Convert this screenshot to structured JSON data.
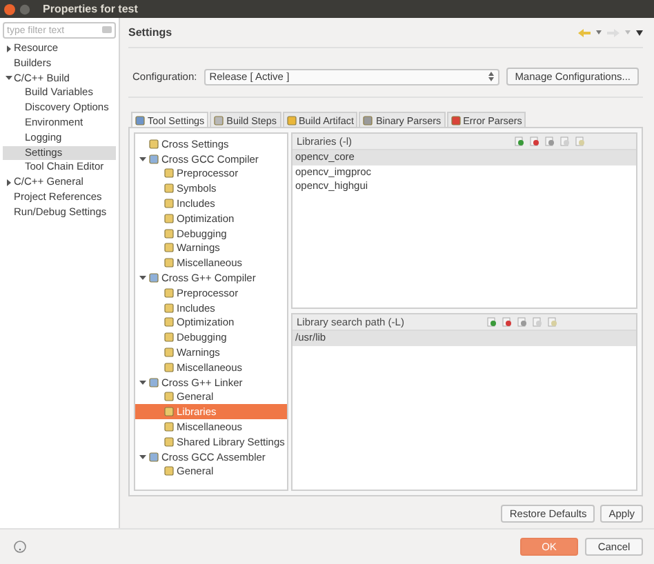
{
  "window": {
    "title": "Properties for test"
  },
  "filter": {
    "placeholder": "type filter text"
  },
  "sidebar": {
    "items": [
      {
        "label": "Resource",
        "expanded": false,
        "selected": false
      },
      {
        "label": "Builders",
        "selected": false
      },
      {
        "label": "C/C++ Build",
        "expanded": true,
        "selected": false,
        "children": [
          {
            "label": "Build Variables",
            "selected": false
          },
          {
            "label": "Discovery Options",
            "selected": false
          },
          {
            "label": "Environment",
            "selected": false
          },
          {
            "label": "Logging",
            "selected": false
          },
          {
            "label": "Settings",
            "selected": true
          },
          {
            "label": "Tool Chain Editor",
            "selected": false
          }
        ]
      },
      {
        "label": "C/C++ General",
        "expanded": false,
        "selected": false
      },
      {
        "label": "Project References",
        "selected": false
      },
      {
        "label": "Run/Debug Settings",
        "selected": false
      }
    ]
  },
  "page_title": "Settings",
  "configuration": {
    "label": "Configuration:",
    "value": "Release  [ Active ]",
    "button": "Manage Configurations..."
  },
  "tabs": [
    {
      "label": "Tool Settings",
      "selected": true
    },
    {
      "label": "Build Steps",
      "selected": false
    },
    {
      "label": "Build Artifact",
      "selected": false
    },
    {
      "label": "Binary Parsers",
      "selected": false
    },
    {
      "label": "Error Parsers",
      "selected": false
    }
  ],
  "tool_tree": [
    {
      "label": "Cross Settings",
      "kind": "leaf",
      "selected": false
    },
    {
      "label": "Cross GCC Compiler",
      "kind": "tool",
      "expanded": true,
      "children": [
        {
          "label": "Preprocessor",
          "kind": "leaf",
          "selected": false
        },
        {
          "label": "Symbols",
          "kind": "leaf",
          "selected": false
        },
        {
          "label": "Includes",
          "kind": "leaf",
          "selected": false
        },
        {
          "label": "Optimization",
          "kind": "leaf",
          "selected": false
        },
        {
          "label": "Debugging",
          "kind": "leaf",
          "selected": false
        },
        {
          "label": "Warnings",
          "kind": "leaf",
          "selected": false
        },
        {
          "label": "Miscellaneous",
          "kind": "leaf",
          "selected": false
        }
      ]
    },
    {
      "label": "Cross G++ Compiler",
      "kind": "tool",
      "expanded": true,
      "children": [
        {
          "label": "Preprocessor",
          "kind": "leaf",
          "selected": false
        },
        {
          "label": "Includes",
          "kind": "leaf",
          "selected": false
        },
        {
          "label": "Optimization",
          "kind": "leaf",
          "selected": false
        },
        {
          "label": "Debugging",
          "kind": "leaf",
          "selected": false
        },
        {
          "label": "Warnings",
          "kind": "leaf",
          "selected": false
        },
        {
          "label": "Miscellaneous",
          "kind": "leaf",
          "selected": false
        }
      ]
    },
    {
      "label": "Cross G++ Linker",
      "kind": "tool",
      "expanded": true,
      "children": [
        {
          "label": "General",
          "kind": "leaf",
          "selected": false
        },
        {
          "label": "Libraries",
          "kind": "leaf",
          "selected": true
        },
        {
          "label": "Miscellaneous",
          "kind": "leaf",
          "selected": false
        },
        {
          "label": "Shared Library Settings",
          "kind": "leaf",
          "selected": false
        }
      ]
    },
    {
      "label": "Cross GCC Assembler",
      "kind": "tool",
      "expanded": true,
      "children": [
        {
          "label": "General",
          "kind": "leaf",
          "selected": false
        }
      ]
    }
  ],
  "lists": [
    {
      "title": "Libraries (-l)",
      "items": [
        {
          "text": "opencv_core",
          "selected": true
        },
        {
          "text": "opencv_imgproc",
          "selected": false
        },
        {
          "text": "opencv_highgui",
          "selected": false
        }
      ]
    },
    {
      "title": "Library search path (-L)",
      "items": [
        {
          "text": "/usr/lib",
          "selected": true
        }
      ]
    }
  ],
  "page_buttons": [
    "Restore Defaults",
    "Apply"
  ],
  "dialog_buttons": [
    {
      "label": "OK",
      "default": true
    },
    {
      "label": "Cancel",
      "default": false
    }
  ]
}
